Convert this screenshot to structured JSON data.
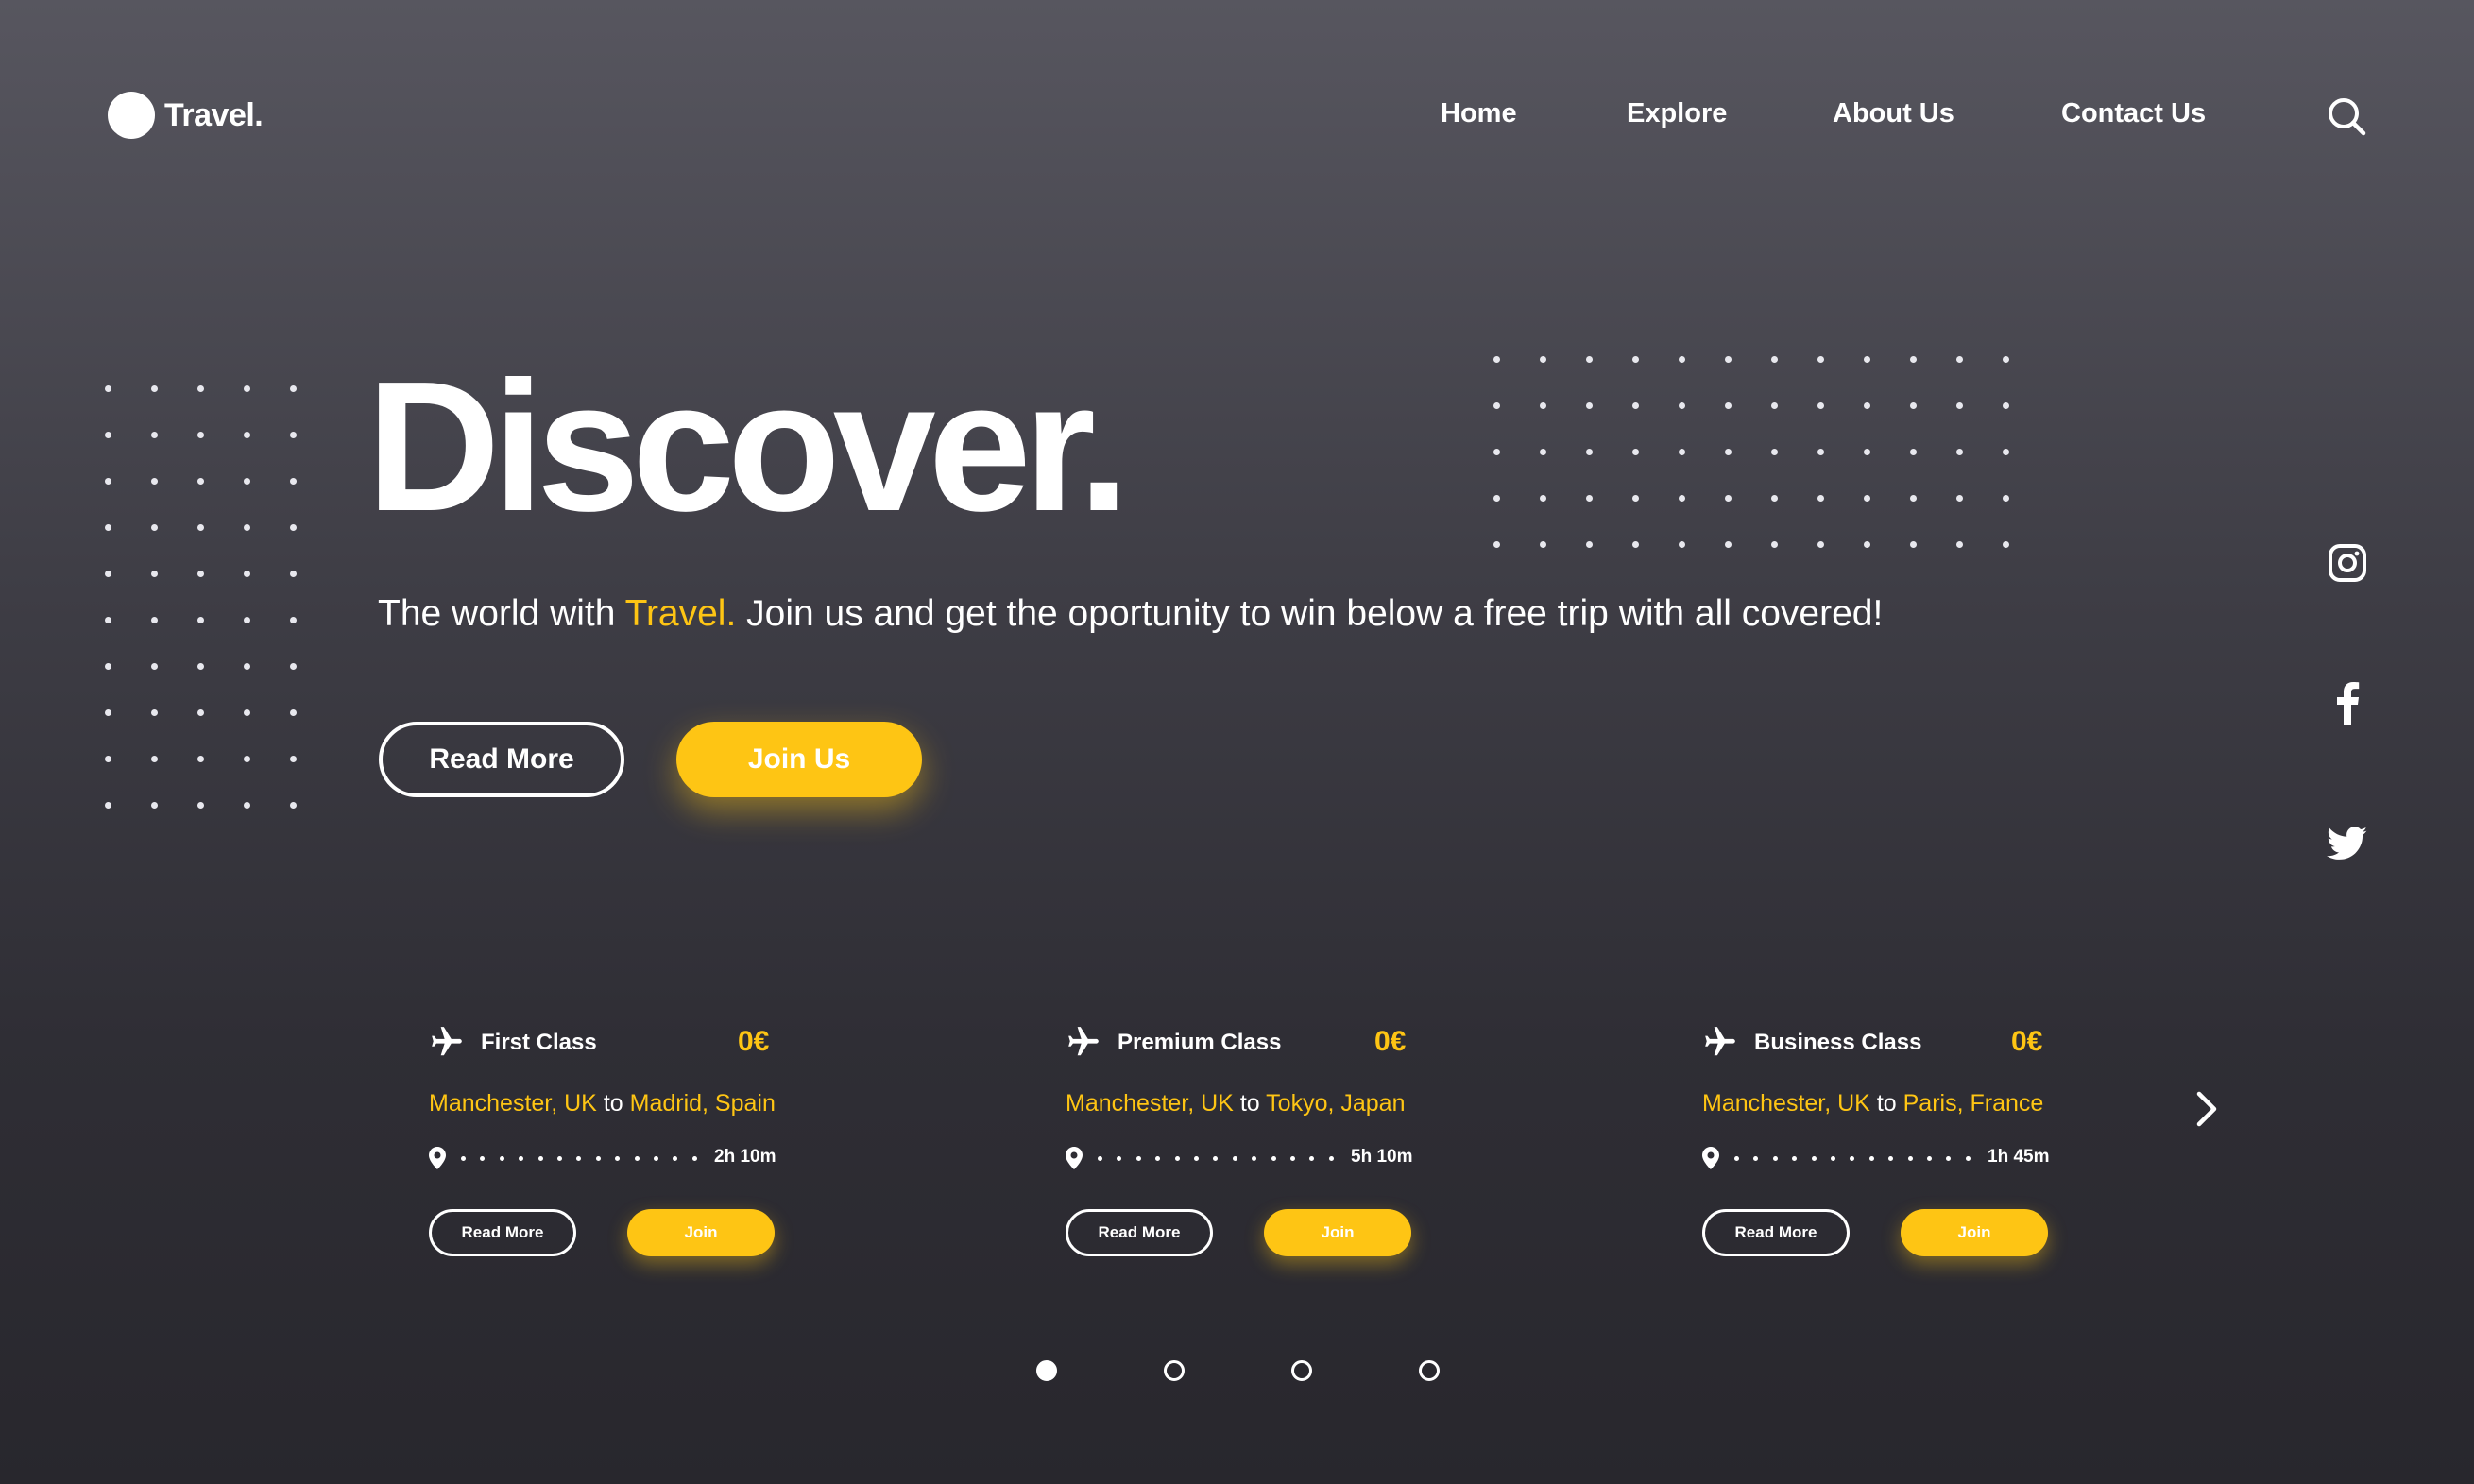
{
  "brand": {
    "name": "Travel."
  },
  "nav": {
    "items": [
      {
        "label": "Home"
      },
      {
        "label": "Explore"
      },
      {
        "label": "About Us"
      },
      {
        "label": "Contact Us"
      }
    ],
    "search_icon": "search-icon"
  },
  "hero": {
    "title": "Discover.",
    "subtitle_before": "The world with ",
    "subtitle_accent": "Travel.",
    "subtitle_after": " Join us and get the oportunity to win below a free trip with all covered!",
    "read_more_label": "Read More",
    "join_label": "Join Us"
  },
  "social": [
    {
      "icon": "instagram-icon"
    },
    {
      "icon": "facebook-icon"
    },
    {
      "icon": "twitter-icon"
    }
  ],
  "cards": [
    {
      "class": "First Class",
      "price": "0€",
      "from": "Manchester, UK",
      "to_word": "to",
      "to": "Madrid, Spain",
      "duration": "2h 10m",
      "read_label": "Read More",
      "join_label": "Join"
    },
    {
      "class": "Premium Class",
      "price": "0€",
      "from": "Manchester, UK",
      "to_word": "to",
      "to": "Tokyo, Japan",
      "duration": "5h 10m",
      "read_label": "Read More",
      "join_label": "Join"
    },
    {
      "class": "Business Class",
      "price": "0€",
      "from": "Manchester, UK",
      "to_word": "to",
      "to": "Paris, France",
      "duration": "1h 45m",
      "read_label": "Read More",
      "join_label": "Join"
    }
  ],
  "carousel": {
    "pages": 4,
    "active_page": 1
  },
  "colors": {
    "accent": "#fec514",
    "text": "#ffffff",
    "background_top": "#57565f",
    "background_bottom": "#28272d"
  }
}
